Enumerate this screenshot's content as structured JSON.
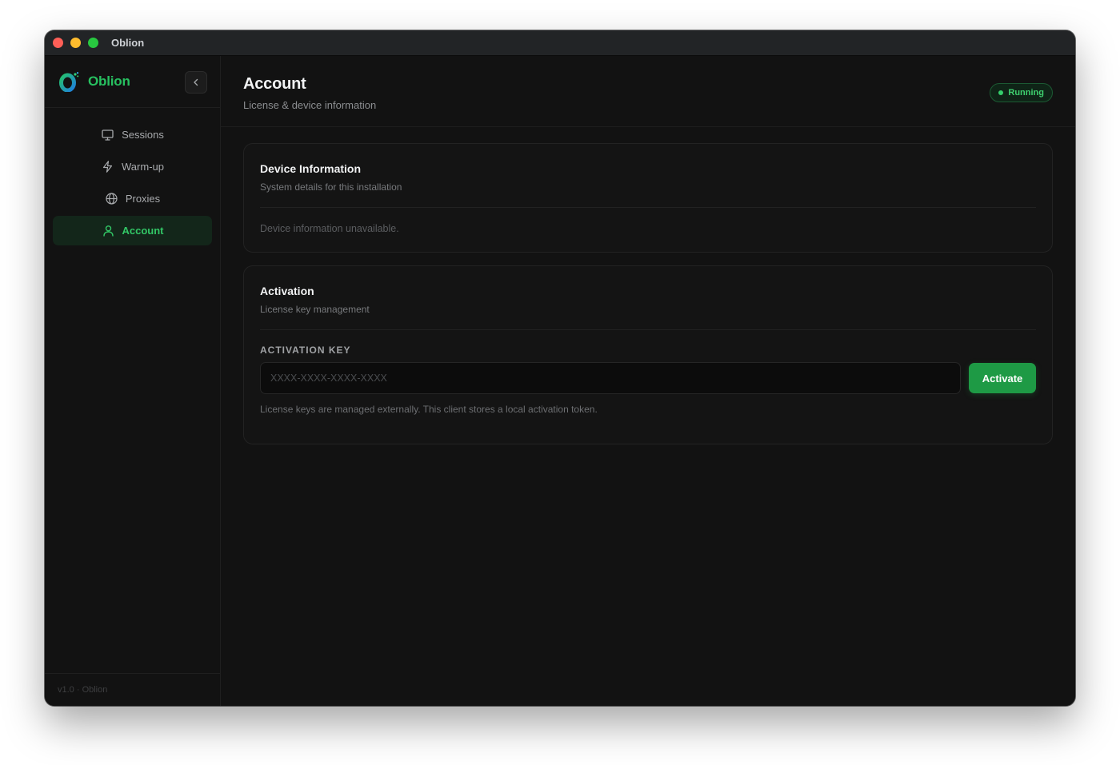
{
  "window": {
    "title": "Oblion"
  },
  "sidebar": {
    "brand": "Oblion",
    "items": [
      {
        "label": "Sessions",
        "icon": "monitor-icon",
        "active": false
      },
      {
        "label": "Warm-up",
        "icon": "lightning-icon",
        "active": false
      },
      {
        "label": "Proxies",
        "icon": "globe-icon",
        "active": false
      },
      {
        "label": "Account",
        "icon": "user-icon",
        "active": true
      }
    ],
    "footer": "v1.0 · Oblion"
  },
  "header": {
    "title": "Account",
    "subtitle": "License & device information",
    "status": "Running"
  },
  "device_card": {
    "title": "Device Information",
    "description": "System details for this installation",
    "empty_message": "Device information unavailable."
  },
  "activation_card": {
    "title": "Activation",
    "description": "License key management",
    "field_label": "ACTIVATION KEY",
    "input_value": "",
    "input_placeholder": "XXXX-XXXX-XXXX-XXXX",
    "button_label": "Activate",
    "help_text": "License keys are managed externally. This client stores a local activation token."
  },
  "colors": {
    "accent": "#27c160",
    "button": "#1e9a45",
    "background": "#121212"
  }
}
